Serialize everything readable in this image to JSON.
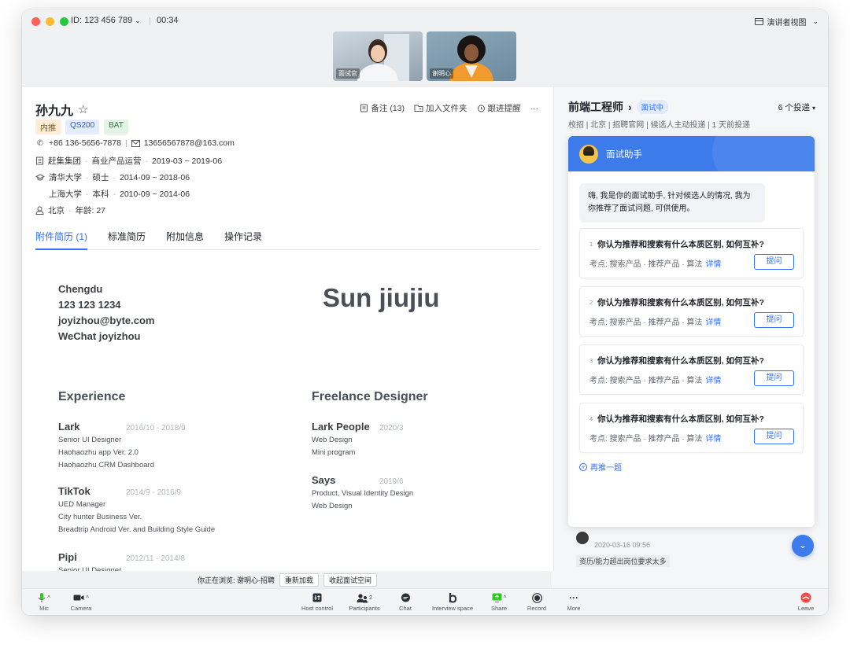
{
  "titlebar": {
    "meeting_id": "ID: 123 456 789",
    "timer": "00:34",
    "presenter_view": "演讲者视图"
  },
  "videos": [
    {
      "label": "面试官"
    },
    {
      "label": "谢明心"
    }
  ],
  "candidate": {
    "name": "孙九九",
    "tags": [
      "内推",
      "QS200",
      "BAT"
    ],
    "phone": "+86 136-5656-7878",
    "email": "13656567878@163.com",
    "work": [
      "赶集集团",
      "商业产品运营",
      "2019-03 ~ 2019-06"
    ],
    "edu1": [
      "清华大学",
      "硕士",
      "2014-09 ~ 2018-06"
    ],
    "edu2": [
      "上海大学",
      "本科",
      "2010-09 ~ 2014-06"
    ],
    "location": [
      "北京",
      "年龄: 27"
    ]
  },
  "actions": {
    "note": "备注 (13)",
    "add_folder": "加入文件夹",
    "follow": "跟进提醒",
    "more": "···"
  },
  "tabs": [
    "附件简历 (1)",
    "标准简历",
    "附加信息",
    "操作记录"
  ],
  "resume": {
    "contact": [
      "Chengdu",
      "123 123 1234",
      "joyizhou@byte.com",
      "WeChat joyizhou"
    ],
    "name": "Sun jiujiu",
    "experience_heading": "Experience",
    "freelance_heading": "Freelance Designer",
    "experience": [
      {
        "company": "Lark",
        "date": "2016/10 - 2018/9",
        "lines": [
          "Senior UI Designer",
          "Haohaozhu app Ver. 2.0",
          "Haohaozhu CRM Dashboard"
        ]
      },
      {
        "company": "TikTok",
        "date": "2014/9 - 2016/9",
        "lines": [
          "UED Manager",
          "City hunter Business Ver.",
          "Breadtrip Android Ver. and Building Style Guide"
        ]
      },
      {
        "company": "Pipi",
        "date": "2012/11 - 2014/8",
        "lines": [
          "Senior UI Designer"
        ]
      }
    ],
    "freelance": [
      {
        "company": "Lark People",
        "date": "2020/3",
        "lines": [
          "Web Design",
          "Mini program"
        ]
      },
      {
        "company": "Says",
        "date": "2019/6",
        "lines": [
          "Product, Visual Identity Design",
          "Web Design"
        ]
      }
    ]
  },
  "job": {
    "title": "前端工程师",
    "status": "面试中",
    "deliveries": "6 个投递",
    "meta": "校招 | 北京 | 招聘官网 | 候选人主动投递 | 1 天前投递"
  },
  "assistant": {
    "title": "面试助手",
    "greeting": "嗨, 我是你的面试助手, 针对候选人的情况, 我为你推荐了面试问题, 可供使用。",
    "kp_label": "考点: 搜索产品 · 推荐产品 · 算法",
    "detail_label": "详情",
    "ask_label": "提问",
    "questions": [
      {
        "num": "1",
        "text": "你认为推荐和搜索有什么本质区别, 如何互补?"
      },
      {
        "num": "2",
        "text": "你认为推荐和搜索有什么本质区别, 如何互补?"
      },
      {
        "num": "3",
        "text": "你认为推荐和搜索有什么本质区别, 如何互补?"
      },
      {
        "num": "4",
        "text": "你认为推荐和搜索有什么本质区别, 如何互补?"
      }
    ],
    "more_label": "再推一题"
  },
  "comment": {
    "time": "2020-03-16 09:56",
    "tag": "资历/能力超出岗位要求太多"
  },
  "browse": {
    "text": "你正在浏览: 谢明心-招聘",
    "reload": "重新加载",
    "collapse": "收起面试空间"
  },
  "toolbar": {
    "mic": "Mic",
    "camera": "Camera",
    "host_control": "Host control",
    "participants": "Participants",
    "participants_count": "2",
    "chat": "Chat",
    "interview_space": "Interview space",
    "share": "Share",
    "record": "Record",
    "more": "More",
    "leave": "Leave"
  },
  "colors": {
    "accent": "#3370ff",
    "assistant_header": "#3d7bea",
    "leave": "#f54a45",
    "share": "#34c724"
  }
}
